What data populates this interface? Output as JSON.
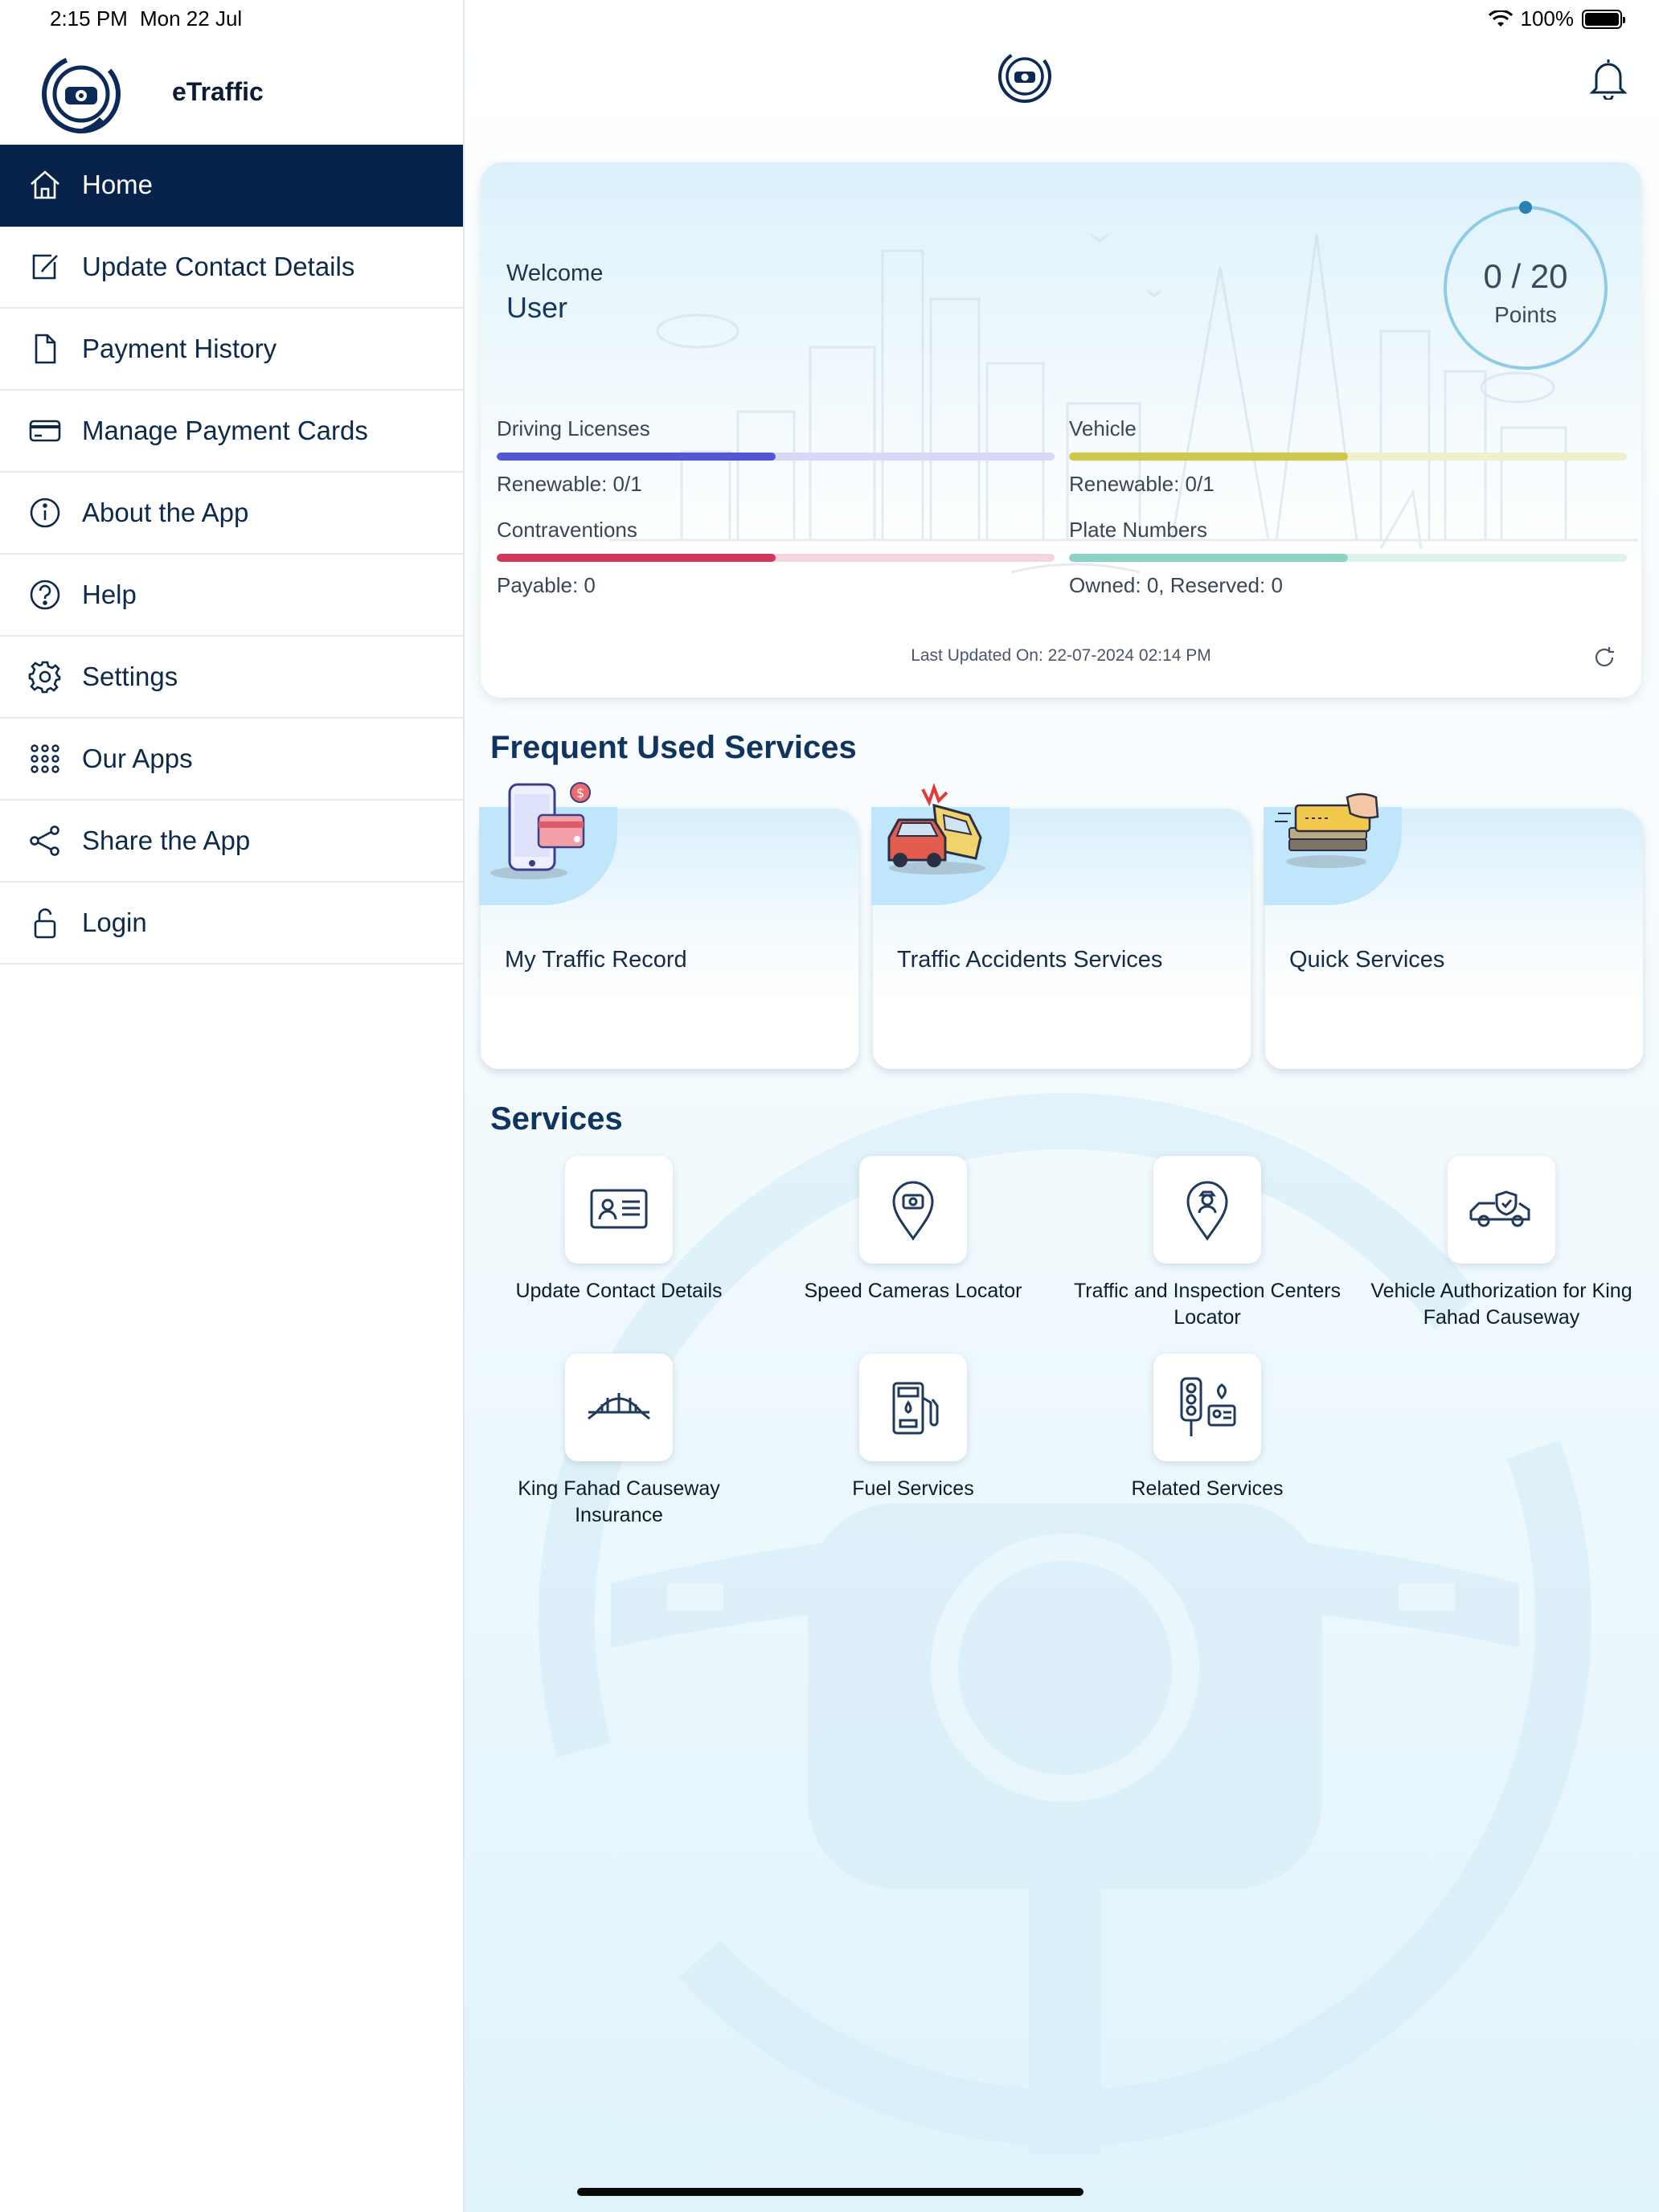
{
  "status_bar": {
    "time": "2:15 PM",
    "date": "Mon 22 Jul",
    "battery": "100%"
  },
  "sidebar": {
    "app_name": "eTraffic",
    "items": [
      {
        "label": "Home",
        "icon": "home-icon",
        "active": true
      },
      {
        "label": "Update Contact Details",
        "icon": "edit-icon"
      },
      {
        "label": "Payment History",
        "icon": "document-icon"
      },
      {
        "label": "Manage Payment Cards",
        "icon": "credit-card-icon"
      },
      {
        "label": "About the App",
        "icon": "info-icon"
      },
      {
        "label": "Help",
        "icon": "help-icon"
      },
      {
        "label": "Settings",
        "icon": "gear-icon"
      },
      {
        "label": "Our Apps",
        "icon": "apps-grid-icon"
      },
      {
        "label": "Share the App",
        "icon": "share-icon"
      },
      {
        "label": "Login",
        "icon": "unlock-icon"
      }
    ]
  },
  "welcome": {
    "greeting": "Welcome",
    "user": "User",
    "points": {
      "value": "0 / 20",
      "label": "Points"
    },
    "stats": [
      {
        "title": "Driving Licenses",
        "sub": "Renewable: 0/1",
        "color": "#5257d8",
        "track": "#d7d8f5",
        "fill": 0.5
      },
      {
        "title": "Vehicle",
        "sub": "Renewable: 0/1",
        "color": "#cfc84a",
        "track": "#f1f0cd",
        "fill": 0.5
      },
      {
        "title": "Contraventions",
        "sub": "Payable: 0",
        "color": "#d2375e",
        "track": "#f6d4dd",
        "fill": 0.5
      },
      {
        "title": "Plate Numbers",
        "sub": "Owned: 0, Reserved: 0",
        "color": "#8bd3c4",
        "track": "#ddf3ee",
        "fill": 0.5
      }
    ],
    "last_updated": "Last Updated On: 22-07-2024 02:14 PM"
  },
  "frequent": {
    "title": "Frequent Used Services",
    "items": [
      {
        "label": "My Traffic Record"
      },
      {
        "label": "Traffic Accidents Services"
      },
      {
        "label": "Quick Services"
      }
    ]
  },
  "services": {
    "title": "Services",
    "items": [
      {
        "label": "Update Contact Details",
        "icon": "id-card-icon"
      },
      {
        "label": "Speed Cameras Locator",
        "icon": "camera-pin-icon"
      },
      {
        "label": "Traffic and Inspection Centers Locator",
        "icon": "officer-pin-icon"
      },
      {
        "label": "Vehicle Authorization for King Fahad Causeway",
        "icon": "car-shield-icon"
      },
      {
        "label": "King Fahad Causeway Insurance",
        "icon": "bridge-icon"
      },
      {
        "label": "Fuel Services",
        "icon": "fuel-pump-icon"
      },
      {
        "label": "Related Services",
        "icon": "traffic-light-icon"
      }
    ]
  },
  "colors": {
    "nav_active": "#08234a",
    "primary_text": "#0f3460",
    "accent_light": "#bfe6fa"
  }
}
